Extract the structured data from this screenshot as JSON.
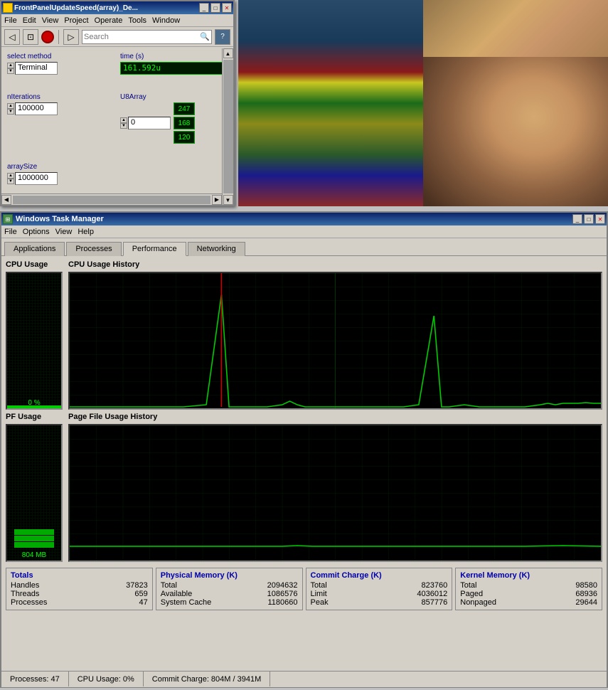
{
  "labview": {
    "title": "FrontPanelUpdateSpeed(array)_De...",
    "method_label": "select method",
    "method_value": "Terminal",
    "time_label": "time (s)",
    "time_value": "161.592u",
    "nIterations_label": "nIterations",
    "nIterations_value": "100000",
    "arraySize_label": "arraySize",
    "arraySize_value": "1000000",
    "u8array_label": "U8Array",
    "spinner_value": "0",
    "array_values": [
      "247",
      "168",
      "120"
    ],
    "cpu_percent": "0 %",
    "menus": [
      "File",
      "Edit",
      "View",
      "Project",
      "Operate",
      "Tools",
      "Window"
    ],
    "search_placeholder": "Search"
  },
  "taskman": {
    "title": "Windows Task Manager",
    "menus": [
      "File",
      "Options",
      "View",
      "Help"
    ],
    "tabs": [
      "Applications",
      "Processes",
      "Performance",
      "Networking"
    ],
    "active_tab": "Performance",
    "sections": {
      "cpu_usage_label": "CPU Usage",
      "cpu_history_label": "CPU Usage History",
      "pf_usage_label": "PF Usage",
      "pf_history_label": "Page File Usage History",
      "cpu_percent": "0 %",
      "pf_mb": "804 MB"
    },
    "totals": {
      "title": "Totals",
      "handles_label": "Handles",
      "handles_value": "37823",
      "threads_label": "Threads",
      "threads_value": "659",
      "processes_label": "Processes",
      "processes_value": "47"
    },
    "physical_memory": {
      "title": "Physical Memory (K)",
      "total_label": "Total",
      "total_value": "2094632",
      "available_label": "Available",
      "available_value": "1086576",
      "system_cache_label": "System Cache",
      "system_cache_value": "1180660"
    },
    "commit_charge": {
      "title": "Commit Charge (K)",
      "total_label": "Total",
      "total_value": "823760",
      "limit_label": "Limit",
      "limit_value": "4036012",
      "peak_label": "Peak",
      "peak_value": "857776"
    },
    "kernel_memory": {
      "title": "Kernel Memory (K)",
      "total_label": "Total",
      "total_value": "98580",
      "paged_label": "Paged",
      "paged_value": "68936",
      "nonpaged_label": "Nonpaged",
      "nonpaged_value": "29644"
    },
    "statusbar": {
      "processes_label": "Processes: 47",
      "cpu_label": "CPU Usage: 0%",
      "commit_label": "Commit Charge: 804M / 3941M"
    }
  }
}
